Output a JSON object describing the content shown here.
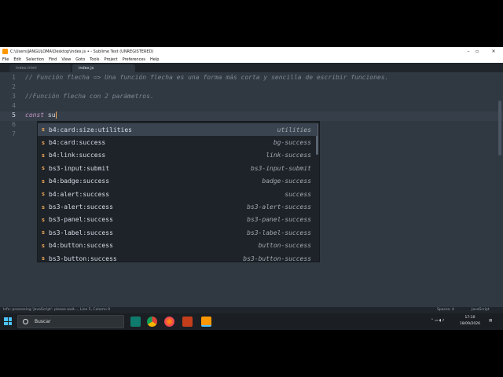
{
  "window": {
    "title": "C:\\Users\\JANGULOMA\\Desktop\\index.js • - Sublime Text (UNREGISTERED)",
    "controls": [
      "–",
      "▫",
      "✕"
    ]
  },
  "menu": [
    "File",
    "Edit",
    "Selection",
    "Find",
    "View",
    "Goto",
    "Tools",
    "Project",
    "Preferences",
    "Help"
  ],
  "tabs": [
    {
      "label": "index.html",
      "active": false
    },
    {
      "label": "index.js",
      "active": true
    }
  ],
  "editor": {
    "lines": [
      {
        "n": "1",
        "text": "// Función flecha => Una función flecha es una forma más corta y sencilla de escribir funciones."
      },
      {
        "n": "2",
        "text": ""
      },
      {
        "n": "3",
        "text": "//Función flecha con 2 parámetros."
      },
      {
        "n": "4",
        "text": ""
      },
      {
        "n": "5",
        "keyword": "const",
        "text": "su"
      },
      {
        "n": "6",
        "text": ""
      },
      {
        "n": "7",
        "text": ""
      }
    ]
  },
  "autocomplete": {
    "kind_letter": "s",
    "items": [
      {
        "trigger": "b4:card:size:utilities",
        "annotation": "utilities"
      },
      {
        "trigger": "b4:card:success",
        "annotation": "bg-success"
      },
      {
        "trigger": "b4:link:success",
        "annotation": "link-success"
      },
      {
        "trigger": "bs3-input:submit",
        "annotation": "bs3-input-submit"
      },
      {
        "trigger": "b4:badge:success",
        "annotation": "badge-success"
      },
      {
        "trigger": "b4:alert:success",
        "annotation": "success"
      },
      {
        "trigger": "bs3-alert:success",
        "annotation": "bs3-alert-success"
      },
      {
        "trigger": "bs3-panel:success",
        "annotation": "bs3-panel-success"
      },
      {
        "trigger": "bs3-label:success",
        "annotation": "bs3-label-success"
      },
      {
        "trigger": "b4:button:success",
        "annotation": "button-success"
      },
      {
        "trigger": "bs3-button:success",
        "annotation": "bs3-button-success"
      }
    ]
  },
  "status": {
    "left": "Info: processing 'JavaScript': please wait..., Line 5, Column 9",
    "spaces": "Spaces: 4",
    "syntax": "JavaScript"
  },
  "taskbar": {
    "search_placeholder": "Buscar",
    "time": "17:10",
    "date": "18/09/2026"
  },
  "colors": {
    "editor_bg": "#303841",
    "accent": "#f9ae58",
    "keyword": "#c695c6",
    "comment": "#7b8794"
  }
}
